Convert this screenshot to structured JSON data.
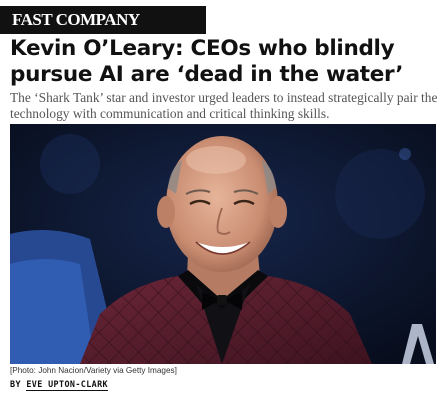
{
  "masthead": {
    "logo_text": "FAST COMPANY"
  },
  "article": {
    "headline": "Kevin O’Leary: CEOs who blindly pursue AI are ‘dead in the water’",
    "dek": "The ‘Shark Tank’ star and investor urged leaders to instead strategically pair the technology with communication and critical thinking skills.",
    "photo_caption": "[Photo: John Nacion/Variety via Getty Images]",
    "byline_prefix": "BY",
    "author": "EVE UPTON-CLARK"
  },
  "colors": {
    "masthead_bg": "#111111",
    "photo_bg": "#0c1528",
    "jacket": "#5a1e2e"
  }
}
